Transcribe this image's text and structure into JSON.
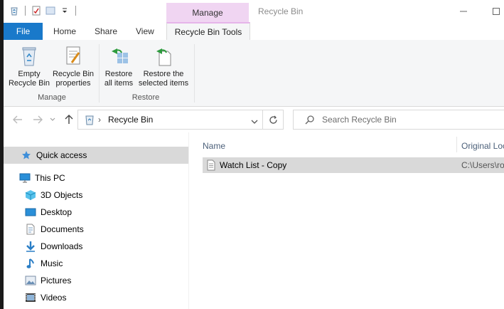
{
  "window": {
    "title": "Recycle Bin",
    "context_tab_group": "Manage"
  },
  "ribbon_tabs": {
    "file": "File",
    "home": "Home",
    "share": "Share",
    "view": "View",
    "recycle_bin_tools": "Recycle Bin Tools"
  },
  "ribbon": {
    "manage_group": {
      "label": "Manage",
      "empty": "Empty\nRecycle Bin",
      "properties": "Recycle Bin\nproperties"
    },
    "restore_group": {
      "label": "Restore",
      "restore_all": "Restore\nall items",
      "restore_selected": "Restore the\nselected items"
    }
  },
  "address": {
    "location": "Recycle Bin",
    "search_placeholder": "Search Recycle Bin"
  },
  "nav_pane": {
    "items": [
      {
        "label": "Quick access",
        "icon": "star-icon"
      },
      {
        "label": "This PC",
        "icon": "computer-icon"
      },
      {
        "label": "3D Objects",
        "icon": "cube-icon"
      },
      {
        "label": "Desktop",
        "icon": "desktop-icon"
      },
      {
        "label": "Documents",
        "icon": "document-icon"
      },
      {
        "label": "Downloads",
        "icon": "download-icon"
      },
      {
        "label": "Music",
        "icon": "music-icon"
      },
      {
        "label": "Pictures",
        "icon": "pictures-icon"
      },
      {
        "label": "Videos",
        "icon": "video-icon"
      }
    ]
  },
  "content": {
    "columns": {
      "name": "Name",
      "original_location": "Original Loc"
    },
    "rows": [
      {
        "name": "Watch List - Copy",
        "original_location": "C:\\Users\\ro"
      }
    ]
  },
  "colors": {
    "file_tab": "#1979ca",
    "context_tab": "#f0d5f2",
    "selection": "#d9d9d9"
  }
}
